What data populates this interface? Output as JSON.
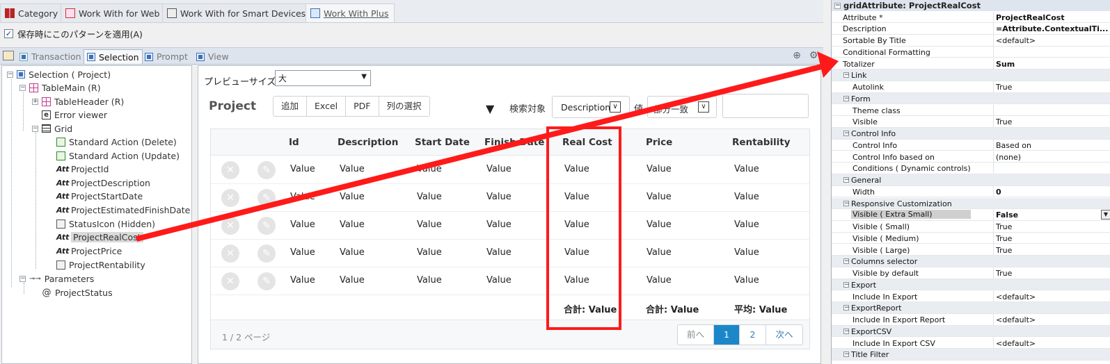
{
  "doc_tabs": [
    {
      "label": "Category",
      "icon": "category-icon"
    },
    {
      "label": "Work With for Web",
      "icon": "web-icon"
    },
    {
      "label": "Work With for Smart Devices",
      "icon": "smart-devices-icon"
    },
    {
      "label": "Work With Plus",
      "icon": "workwithplus-icon"
    }
  ],
  "apply_checkbox": {
    "label": "保存時にこのパターンを適用(A)",
    "checked": true
  },
  "pattern_tabs": [
    "Transaction",
    "Selection",
    "Prompt",
    "View"
  ],
  "tree": {
    "nodes": [
      {
        "label": "Selection ( Project)"
      },
      {
        "label": "TableMain (R)"
      },
      {
        "label": "TableHeader (R)"
      },
      {
        "label": "Error viewer"
      },
      {
        "label": "Grid"
      },
      {
        "label": "Standard Action (Delete)"
      },
      {
        "label": "Standard Action (Update)"
      },
      {
        "label": "ProjectId"
      },
      {
        "label": "ProjectDescription"
      },
      {
        "label": "ProjectStartDate"
      },
      {
        "label": "ProjectEstimatedFinishDate"
      },
      {
        "label": "StatusIcon (Hidden)"
      },
      {
        "label": "ProjectRealCost"
      },
      {
        "label": "ProjectPrice"
      },
      {
        "label": "ProjectRentability"
      },
      {
        "label": "Parameters"
      },
      {
        "label": "ProjectStatus"
      }
    ],
    "att_prefix": "Att"
  },
  "preview": {
    "size_label": "プレビューサイズ",
    "size_value": "大",
    "title": "Project",
    "buttons": [
      "追加",
      "Excel",
      "PDF",
      "列の選択"
    ],
    "search_label": "検索対象",
    "search_field": "Description",
    "value_label": "値",
    "match_value": "部分一致",
    "grid": {
      "columns": [
        "Id",
        "Description",
        "Start Date",
        "Finish Date",
        "Real Cost",
        "Price",
        "Rentability"
      ],
      "cell_value": "Value",
      "row_count": 5,
      "totals": [
        "合計: Value",
        "合計: Value",
        "平均: Value"
      ],
      "page_info": "1 / 2 ページ",
      "pager": [
        "前へ",
        "1",
        "2",
        "次へ"
      ]
    }
  },
  "properties": {
    "header": "gridAttribute: ProjectRealCost",
    "rows": [
      {
        "k": "Attribute *",
        "v": "ProjectRealCost",
        "bold": true
      },
      {
        "k": "Description",
        "v": "=Attribute.ContextualTi...",
        "bold": true
      },
      {
        "k": "Sortable By Title",
        "v": "<default>"
      },
      {
        "k": "Conditional Formatting",
        "v": ""
      },
      {
        "k": "Totalizer",
        "v": "Sum",
        "bold": true
      },
      {
        "section": "Link"
      },
      {
        "k": "Autolink",
        "v": "True",
        "sub": true
      },
      {
        "section": "Form"
      },
      {
        "k": "Theme class",
        "v": "",
        "sub": true
      },
      {
        "k": "Visible",
        "v": "True",
        "sub": true
      },
      {
        "section": "Control Info"
      },
      {
        "k": "Control Info",
        "v": "Based on",
        "sub": true
      },
      {
        "k": "Control Info based on",
        "v": "(none)",
        "sub": true
      },
      {
        "k": "Conditions ( Dynamic controls)",
        "v": "",
        "sub": true
      },
      {
        "section": "General"
      },
      {
        "k": "Width",
        "v": "0",
        "sub": true,
        "bold": true
      },
      {
        "section": "Responsive Customization"
      },
      {
        "k": "Visible ( Extra Small)",
        "v": "False",
        "sub": true,
        "bold": true,
        "highlight": true
      },
      {
        "k": "Visible ( Small)",
        "v": "True",
        "sub": true
      },
      {
        "k": "Visible ( Medium)",
        "v": "True",
        "sub": true
      },
      {
        "k": "Visible ( Large)",
        "v": "True",
        "sub": true
      },
      {
        "section": "Columns selector"
      },
      {
        "k": "Visible by default",
        "v": "True",
        "sub": true
      },
      {
        "section": "Export"
      },
      {
        "k": "Include In Export",
        "v": "<default>",
        "sub": true
      },
      {
        "section": "ExportReport"
      },
      {
        "k": "Include In Export Report",
        "v": "<default>",
        "sub": true
      },
      {
        "section": "ExportCSV"
      },
      {
        "k": "Include In Export CSV",
        "v": "<default>",
        "sub": true
      },
      {
        "section": "Title Filter"
      }
    ]
  },
  "annotation": {
    "color": "#ff1a1a"
  }
}
